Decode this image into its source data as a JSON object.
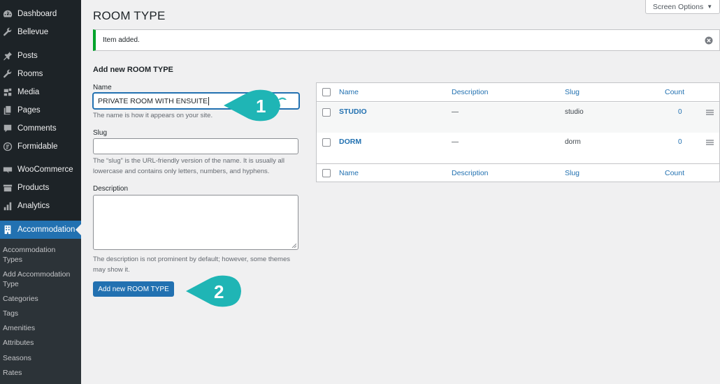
{
  "sidebar": {
    "items": [
      {
        "label": "Dashboard",
        "icon": "dashboard-icon"
      },
      {
        "label": "Bellevue",
        "icon": "wrench-icon"
      },
      {
        "label": "Posts",
        "icon": "pin-icon"
      },
      {
        "label": "Rooms",
        "icon": "wrench-icon"
      },
      {
        "label": "Media",
        "icon": "media-icon"
      },
      {
        "label": "Pages",
        "icon": "pages-icon"
      },
      {
        "label": "Comments",
        "icon": "comment-icon"
      },
      {
        "label": "Formidable",
        "icon": "formidable-icon"
      },
      {
        "label": "WooCommerce",
        "icon": "woo-icon"
      },
      {
        "label": "Products",
        "icon": "products-icon"
      },
      {
        "label": "Analytics",
        "icon": "analytics-icon"
      },
      {
        "label": "Accommodation",
        "icon": "building-icon",
        "active": true
      }
    ],
    "submenu": [
      "Accommodation Types",
      "Add Accommodation Type",
      "Categories",
      "Tags",
      "Amenities",
      "Attributes",
      "Seasons",
      "Rates"
    ]
  },
  "header": {
    "title": "ROOM TYPE",
    "screen_options": "Screen Options"
  },
  "notice": {
    "text": "Item added."
  },
  "form": {
    "heading": "Add new ROOM TYPE",
    "name_label": "Name",
    "name_value": "PRIVATE ROOM WITH ENSUITE",
    "name_help": "The name is how it appears on your site.",
    "slug_label": "Slug",
    "slug_value": "",
    "slug_help": "The “slug” is the URL-friendly version of the name. It is usually all lowercase and contains only letters, numbers, and hyphens.",
    "description_label": "Description",
    "description_help": "The description is not prominent by default; however, some themes may show it.",
    "submit_label": "Add new ROOM TYPE"
  },
  "table": {
    "columns": {
      "name": "Name",
      "description": "Description",
      "slug": "Slug",
      "count": "Count"
    },
    "rows": [
      {
        "name": "STUDIO",
        "description": "—",
        "slug": "studio",
        "count": "0"
      },
      {
        "name": "DORM",
        "description": "—",
        "slug": "dorm",
        "count": "0"
      }
    ]
  },
  "callouts": {
    "first": "1",
    "second": "2"
  },
  "colors": {
    "accent": "#2271b1",
    "sidebar": "#1d2327",
    "callout": "#1fb5b5",
    "success": "#00a32a"
  }
}
